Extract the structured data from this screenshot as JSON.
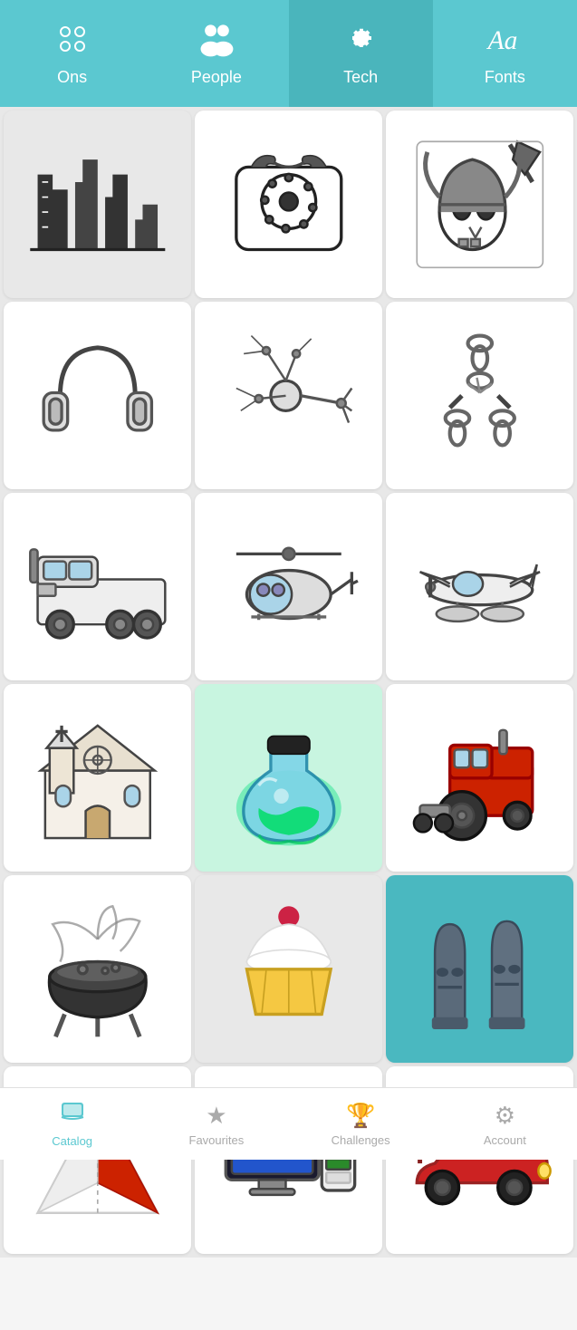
{
  "nav": {
    "tabs": [
      {
        "id": "icons",
        "label": "Ons",
        "icon": "icons-icon",
        "active": false
      },
      {
        "id": "people",
        "label": "People",
        "icon": "people-icon",
        "active": false
      },
      {
        "id": "tech",
        "label": "Tech",
        "icon": "gear-icon",
        "active": true
      },
      {
        "id": "fonts",
        "label": "Fonts",
        "icon": "fonts-icon",
        "active": false
      }
    ]
  },
  "grid": {
    "items": [
      {
        "id": "city",
        "label": "City Skyline",
        "bg": "light"
      },
      {
        "id": "telephone",
        "label": "Rotary Telephone",
        "bg": "white"
      },
      {
        "id": "viking",
        "label": "Viking Helmet",
        "bg": "white"
      },
      {
        "id": "headphones",
        "label": "Headphones",
        "bg": "white"
      },
      {
        "id": "neuron",
        "label": "Neuron",
        "bg": "white"
      },
      {
        "id": "chain",
        "label": "Broken Chain",
        "bg": "white"
      },
      {
        "id": "truck",
        "label": "Big Truck",
        "bg": "white"
      },
      {
        "id": "helicopter",
        "label": "Helicopter",
        "bg": "white"
      },
      {
        "id": "seaplane",
        "label": "Seaplane",
        "bg": "white"
      },
      {
        "id": "church",
        "label": "Church",
        "bg": "white"
      },
      {
        "id": "potion",
        "label": "Magic Potion",
        "bg": "white"
      },
      {
        "id": "tractor",
        "label": "Tractor",
        "bg": "white"
      },
      {
        "id": "cauldron",
        "label": "Cauldron",
        "bg": "white"
      },
      {
        "id": "cupcake",
        "label": "Cupcake",
        "bg": "gray"
      },
      {
        "id": "moai",
        "label": "Easter Island Statues",
        "bg": "teal"
      },
      {
        "id": "pyramid",
        "label": "Origami Pyramid",
        "bg": "white"
      },
      {
        "id": "monitor",
        "label": "Computer Monitor",
        "bg": "white"
      },
      {
        "id": "car",
        "label": "Sports Car",
        "bg": "white"
      }
    ]
  },
  "bottomNav": {
    "tabs": [
      {
        "id": "catalog",
        "label": "Catalog",
        "active": true
      },
      {
        "id": "favourites",
        "label": "Favourites",
        "active": false
      },
      {
        "id": "challenges",
        "label": "Challenges",
        "active": false
      },
      {
        "id": "account",
        "label": "Account",
        "active": false
      }
    ]
  }
}
